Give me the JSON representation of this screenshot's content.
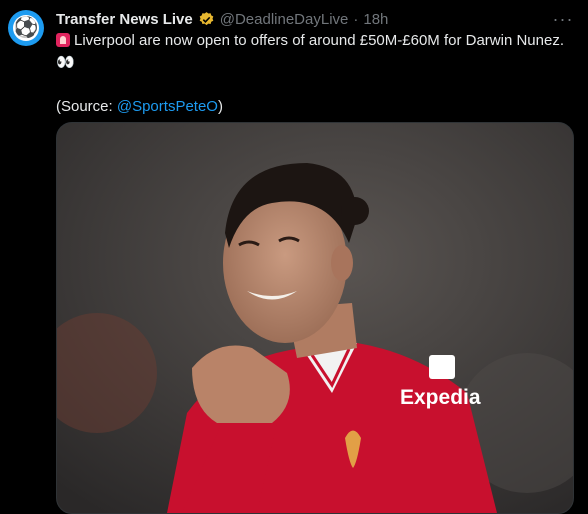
{
  "tweet": {
    "author_name": "Transfer News Live",
    "handle": "@DeadlineDayLive",
    "separator": "·",
    "time": "18h",
    "more_icon": "more-horizontal-icon",
    "line1": "Liverpool are now open to offers of around £50M-£60M for Darwin Nunez.",
    "eyes_emoji": "👀",
    "source_prefix": "(Source: ",
    "source_mention": "@SportsPeteO",
    "source_suffix": ")",
    "siren_icon": "siren-emoji-icon"
  },
  "media": {
    "subject": "footballer-photo",
    "shirt_sponsor": "Expedia",
    "colors": {
      "shirt": "#c8102e",
      "background": "#3a3a3a"
    }
  },
  "colors": {
    "background": "#000000",
    "text": "#e7e9ea",
    "muted": "#71767b",
    "link": "#1d9bf0"
  }
}
